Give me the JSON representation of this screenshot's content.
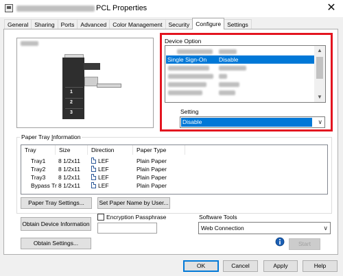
{
  "window": {
    "title": "PCL Properties",
    "close_glyph": "✕"
  },
  "tabs": [
    {
      "label": "General"
    },
    {
      "label": "Sharing"
    },
    {
      "label": "Ports"
    },
    {
      "label": "Advanced"
    },
    {
      "label": "Color Management"
    },
    {
      "label": "Security"
    },
    {
      "label": "Configure"
    },
    {
      "label": "Settings"
    }
  ],
  "preview": {
    "tray_numbers": [
      "1",
      "2",
      "3"
    ]
  },
  "device_option": {
    "label": "Device Option",
    "selected_row": {
      "option": "Single Sign-On",
      "value": "Disable"
    },
    "setting_label": "Setting",
    "setting_value": "Disable"
  },
  "paper_tray": {
    "group_label": "Paper Tray Information",
    "columns": [
      "Tray",
      "Size",
      "Direction",
      "Paper Type"
    ],
    "rows": [
      {
        "tray": "Tray1",
        "size": "8 1/2x11",
        "direction": "LEF",
        "type": "Plain Paper"
      },
      {
        "tray": "Tray2",
        "size": "8 1/2x11",
        "direction": "LEF",
        "type": "Plain Paper"
      },
      {
        "tray": "Tray3",
        "size": "8 1/2x11",
        "direction": "LEF",
        "type": "Plain Paper"
      },
      {
        "tray": "Bypass Tr",
        "size": "8 1/2x11",
        "direction": "LEF",
        "type": "Plain Paper"
      }
    ]
  },
  "buttons": {
    "paper_tray_settings": "Paper Tray Settings...",
    "set_paper_name": "Set Paper Name by User...",
    "obtain_device_info": "Obtain Device Information",
    "obtain_settings": "Obtain Settings...",
    "start": "Start",
    "ok": "OK",
    "cancel": "Cancel",
    "apply": "Apply",
    "help": "Help"
  },
  "encryption": {
    "label": "Encryption Passphrase",
    "checked": false,
    "value": ""
  },
  "software_tools": {
    "label": "Software Tools",
    "selected": "Web Connection"
  },
  "icons": {
    "app": "printer-properties-icon",
    "info": "info-person-icon"
  },
  "colors": {
    "highlight_frame": "#e3141f",
    "selection": "#0078d7"
  }
}
